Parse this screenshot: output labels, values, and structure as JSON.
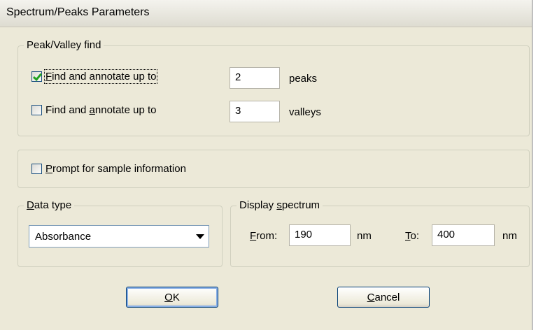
{
  "dialog": {
    "title": "Spectrum/Peaks Parameters"
  },
  "peak_valley": {
    "legend": "Peak/Valley find",
    "peaks_row": {
      "checked": true,
      "label_pre": "F",
      "label_rest": "ind and annotate up to",
      "value": "2",
      "suffix": "peaks"
    },
    "valleys_row": {
      "checked": false,
      "label_pre": "Find and ",
      "label_mnemonic": "a",
      "label_rest": "nnotate up to",
      "value": "3",
      "suffix": "valleys"
    }
  },
  "prompt": {
    "checked": false,
    "label_mnemonic": "P",
    "label_rest": "rompt for sample information"
  },
  "data_type": {
    "legend_mnemonic": "D",
    "legend_rest": "ata type",
    "selected": "Absorbance"
  },
  "display_spectrum": {
    "legend_pre": "Display ",
    "legend_mnemonic": "s",
    "legend_rest": "pectrum",
    "from_mnemonic": "F",
    "from_rest": "rom:",
    "from_value": "190",
    "from_unit": "nm",
    "to_mnemonic": "T",
    "to_rest": "o:",
    "to_value": "400",
    "to_unit": "nm"
  },
  "buttons": {
    "ok_mnemonic": "O",
    "ok_rest": "K",
    "cancel_mnemonic": "C",
    "cancel_rest": "ancel"
  }
}
